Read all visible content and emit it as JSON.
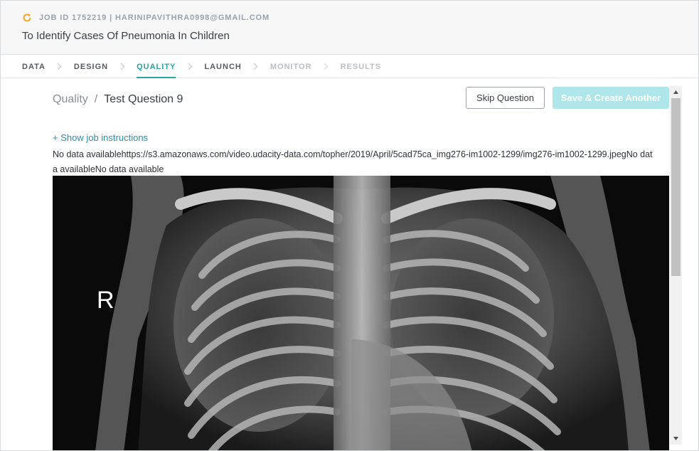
{
  "header": {
    "job_meta": "JOB ID 1752219 | HARINIPAVITHRA0998@GMAIL.COM",
    "title": "To Identify Cases Of Pneumonia In Children",
    "accent_color": "#f5a623"
  },
  "steps": [
    {
      "label": "DATA",
      "state": "done"
    },
    {
      "label": "DESIGN",
      "state": "done"
    },
    {
      "label": "QUALITY",
      "state": "active"
    },
    {
      "label": "LAUNCH",
      "state": "done"
    },
    {
      "label": "MONITOR",
      "state": "disabled"
    },
    {
      "label": "RESULTS",
      "state": "disabled"
    }
  ],
  "breadcrumb": {
    "parent": "Quality",
    "separator": "/",
    "current": "Test Question 9"
  },
  "buttons": {
    "skip": "Skip Question",
    "save": "Save & Create Another"
  },
  "instructions_link": "+ Show job instructions",
  "data_text": "No data availablehttps://s3.amazonaws.com/video.udacity-data.com/topher/2019/April/5cad75ca_img276-im1002-1299/img276-im1002-1299.jpegNo data availableNo data available",
  "image": {
    "marker_label": "R"
  },
  "colors": {
    "active_step": "#2aa3a3",
    "link": "#2d8ea8",
    "save_button_disabled": "#aee6ea"
  }
}
